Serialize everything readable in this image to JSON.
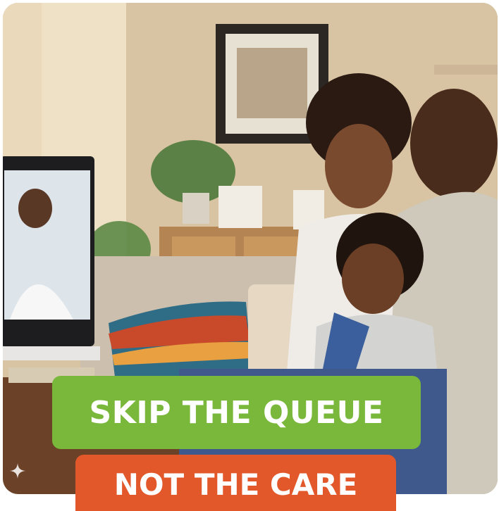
{
  "headline": "SKIP THE QUEUE",
  "subline": "NOT THE CARE",
  "colors": {
    "headline_bg": "#79b83a",
    "subline_bg": "#e2582a",
    "text": "#ffffff"
  },
  "icons": {
    "watermark": "sparkle-icon"
  }
}
